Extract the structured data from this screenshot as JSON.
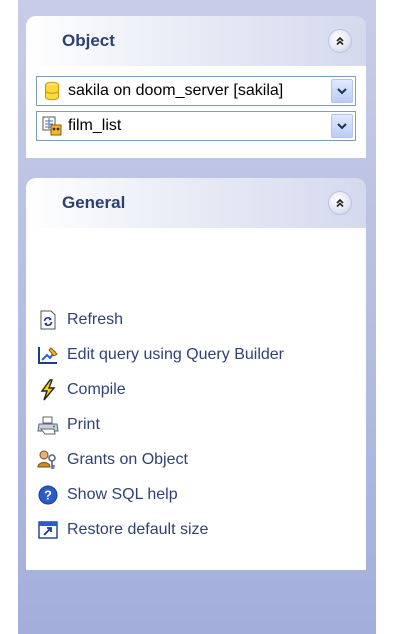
{
  "object_panel": {
    "title": "Object",
    "database_select": {
      "value": "sakila on doom_server [sakila]",
      "icon": "database-icon"
    },
    "object_select": {
      "value": "film_list",
      "icon": "view-icon"
    }
  },
  "general_panel": {
    "title": "General",
    "actions": [
      {
        "label": "Refresh",
        "icon": "refresh-icon"
      },
      {
        "label": "Edit query using Query Builder",
        "icon": "query-builder-icon"
      },
      {
        "label": "Compile",
        "icon": "lightning-icon"
      },
      {
        "label": "Print",
        "icon": "printer-icon"
      },
      {
        "label": "Grants on Object",
        "icon": "users-key-icon"
      },
      {
        "label": "Show SQL help",
        "icon": "help-icon"
      },
      {
        "label": "Restore default size",
        "icon": "restore-window-icon"
      }
    ]
  },
  "colors": {
    "sidebar_gradient_top": "#c7cde8",
    "sidebar_gradient_bottom": "#a3aedb",
    "header_title": "#2d4073",
    "action_text": "#2f4272"
  }
}
